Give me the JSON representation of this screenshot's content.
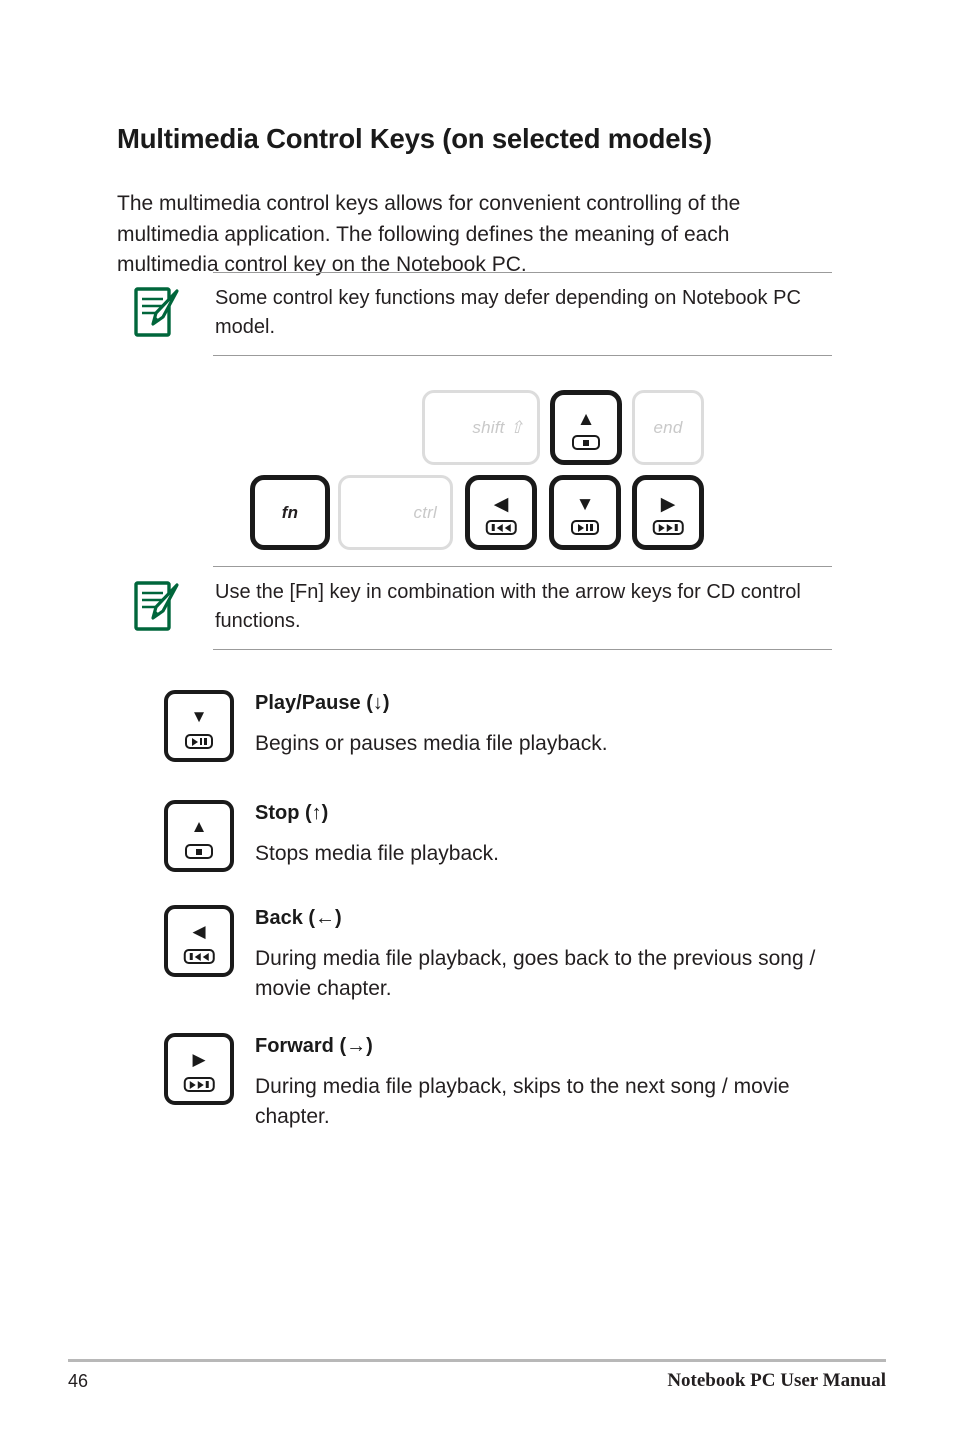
{
  "document": {
    "title": "Multimedia Control Keys (on selected models)",
    "intro": "The multimedia control keys allows for convenient controlling of the multimedia application. The following defines the meaning of each multimedia control key on the Notebook PC.",
    "accent_color": "#00663b",
    "ink_color": "#231f20",
    "dim_key_color": "#dcdcdc"
  },
  "notes": [
    {
      "icon": "note-pencil-icon",
      "text": "Some control key functions may defer depending on Notebook PC model."
    },
    {
      "icon": "note-pencil-icon",
      "text": "Use the [Fn] key in combination with the arrow keys for CD control functions."
    }
  ],
  "keyboard": {
    "keys": [
      {
        "id": "shift",
        "label": "shift",
        "glyph": "⇧",
        "highlighted": false,
        "media": "none",
        "arrow": ""
      },
      {
        "id": "stop",
        "label": "",
        "glyph": "",
        "highlighted": true,
        "media": "stop",
        "arrow": "▲"
      },
      {
        "id": "end",
        "label": "end",
        "glyph": "",
        "highlighted": false,
        "media": "none",
        "arrow": ""
      },
      {
        "id": "fn",
        "label": "fn",
        "glyph": "",
        "highlighted": true,
        "media": "none",
        "arrow": ""
      },
      {
        "id": "ctrl",
        "label": "ctrl",
        "glyph": "",
        "highlighted": false,
        "media": "none",
        "arrow": ""
      },
      {
        "id": "back",
        "label": "",
        "glyph": "",
        "highlighted": true,
        "media": "back",
        "arrow": "◀"
      },
      {
        "id": "play",
        "label": "",
        "glyph": "",
        "highlighted": true,
        "media": "playpause",
        "arrow": "▼"
      },
      {
        "id": "forward",
        "label": "",
        "glyph": "",
        "highlighted": true,
        "media": "forward",
        "arrow": "▶"
      }
    ]
  },
  "entries": [
    {
      "name": "play-pause",
      "title": "Play/Pause",
      "symbol": "(↓)",
      "arrow": "▼",
      "media": "playpause",
      "description": "Begins or pauses media file playback."
    },
    {
      "name": "stop",
      "title": "Stop",
      "symbol": "(↑)",
      "arrow": "▲",
      "media": "stop",
      "description": "Stops media file playback."
    },
    {
      "name": "back",
      "title": "Back",
      "symbol": "(←)",
      "arrow": "◀",
      "media": "back",
      "description": "During media file playback, goes back to the previous song / movie chapter."
    },
    {
      "name": "forward",
      "title": "Forward",
      "symbol": "(→)",
      "arrow": "▶",
      "media": "forward",
      "description": "During media file playback, skips to the next song / movie chapter."
    }
  ],
  "footer": {
    "page_number": "46",
    "manual_title": "Notebook PC User Manual"
  }
}
